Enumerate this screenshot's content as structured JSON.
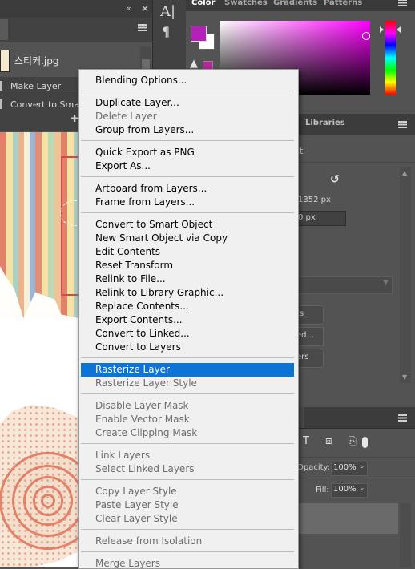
{
  "colors": {
    "ui_bg": "#535353",
    "panel_dark": "#3c3c3c",
    "menu_bg": "#f0f0f0",
    "menu_highlight": "#0b74d6",
    "foreground_color": "#b61fbb",
    "background_color": "#ffffff"
  },
  "layers_panel": {
    "file_name": "스티커.jpg",
    "make_layer": "Make Layer",
    "convert_to_smart": "Convert to Smart O",
    "collapse_icon": "double-chevron-left-icon",
    "close_icon": "close-icon",
    "add_icon": "add-icon"
  },
  "tools": {
    "character_glyph": "A|",
    "paragraph_glyph": "¶",
    "warning_glyph": "▲"
  },
  "color_panel": {
    "tabs": [
      "Color",
      "Swatches",
      "Gradients",
      "Patterns"
    ],
    "active_tab": "Color"
  },
  "properties_panel": {
    "tab_libraries": "Libraries",
    "title_fragment": "ct",
    "rotate_glyph": "↺",
    "width_value": "1352 px",
    "y_value": "0 px",
    "buttons": [
      "ts",
      "ed...",
      "ers"
    ]
  },
  "lower_panel": {
    "filter_glyphs": "T ⧈ ⎘",
    "opacity_label": "Opacity:",
    "opacity_value": "100%",
    "fill_label": "Fill:",
    "fill_value": "100%",
    "chevron": "⌄"
  },
  "context_menu": {
    "items": [
      {
        "label": "Blending Options...",
        "disabled": false
      },
      {
        "label": "Duplicate Layer...",
        "disabled": false
      },
      {
        "label": "Delete Layer",
        "disabled": true
      },
      {
        "label": "Group from Layers...",
        "disabled": false
      },
      {
        "label": "Quick Export as PNG",
        "disabled": false
      },
      {
        "label": "Export As...",
        "disabled": false
      },
      {
        "label": "Artboard from Layers...",
        "disabled": false
      },
      {
        "label": "Frame from Layers...",
        "disabled": false
      },
      {
        "label": "Convert to Smart Object",
        "disabled": false
      },
      {
        "label": "New Smart Object via Copy",
        "disabled": false
      },
      {
        "label": "Edit Contents",
        "disabled": false
      },
      {
        "label": "Reset Transform",
        "disabled": false
      },
      {
        "label": "Relink to File...",
        "disabled": false
      },
      {
        "label": "Relink to Library Graphic...",
        "disabled": false
      },
      {
        "label": "Replace Contents...",
        "disabled": false
      },
      {
        "label": "Export Contents...",
        "disabled": false
      },
      {
        "label": "Convert to Linked...",
        "disabled": false
      },
      {
        "label": "Convert to Layers",
        "disabled": false
      },
      {
        "label": "Rasterize Layer",
        "disabled": false,
        "highlighted": true
      },
      {
        "label": "Rasterize Layer Style",
        "disabled": true
      },
      {
        "label": "Disable Layer Mask",
        "disabled": true
      },
      {
        "label": "Enable Vector Mask",
        "disabled": true
      },
      {
        "label": "Create Clipping Mask",
        "disabled": true
      },
      {
        "label": "Link Layers",
        "disabled": true
      },
      {
        "label": "Select Linked Layers",
        "disabled": true
      },
      {
        "label": "Copy Layer Style",
        "disabled": true
      },
      {
        "label": "Paste Layer Style",
        "disabled": true
      },
      {
        "label": "Clear Layer Style",
        "disabled": true
      },
      {
        "label": "Release from Isolation",
        "disabled": true
      },
      {
        "label": "Merge Layers",
        "disabled": true
      }
    ]
  }
}
